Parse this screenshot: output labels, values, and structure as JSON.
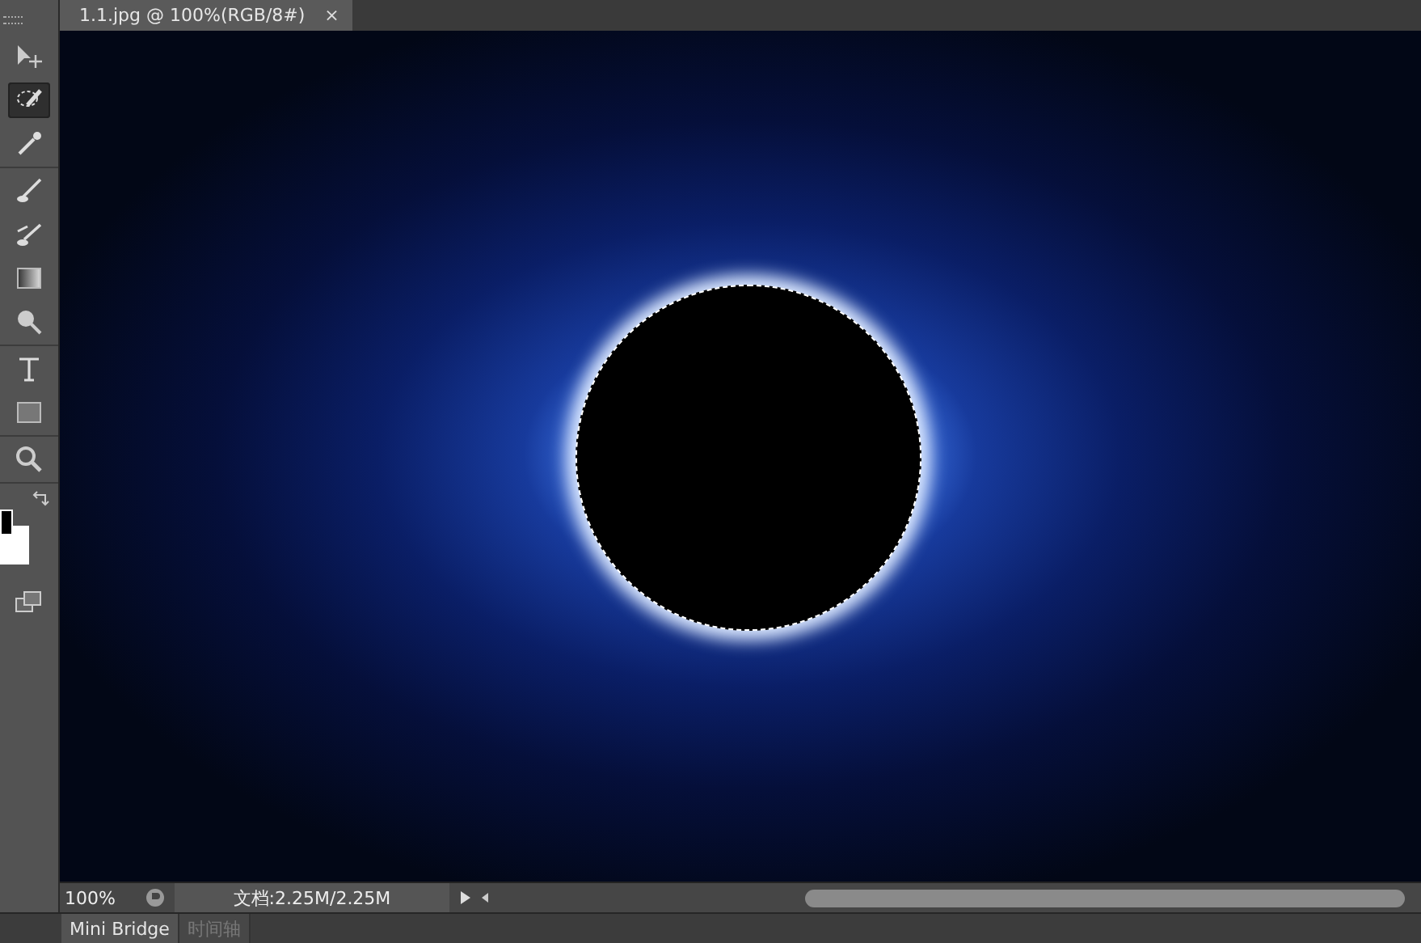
{
  "document_tab": {
    "title": "1.1.jpg @ 100%(RGB/8#)",
    "close": "×"
  },
  "tool_groups": [
    [
      {
        "kind": "move",
        "selected": false
      },
      {
        "kind": "lasso",
        "selected": true
      },
      {
        "kind": "eyedropper",
        "selected": false
      }
    ],
    [
      {
        "kind": "brush",
        "selected": false
      },
      {
        "kind": "history-brush",
        "selected": false
      },
      {
        "kind": "gradient",
        "selected": false
      },
      {
        "kind": "dodge",
        "selected": false
      }
    ],
    [
      {
        "kind": "type",
        "selected": false
      },
      {
        "kind": "rectangle",
        "selected": false
      }
    ],
    [
      {
        "kind": "zoom",
        "selected": false
      }
    ]
  ],
  "status_bar": {
    "zoom": "100%",
    "doc_info": "文档:2.25M/2.25M"
  },
  "panel_tabs": [
    {
      "label": "Mini Bridge",
      "selected": true
    },
    {
      "label": "时间轴",
      "selected": false
    }
  ]
}
